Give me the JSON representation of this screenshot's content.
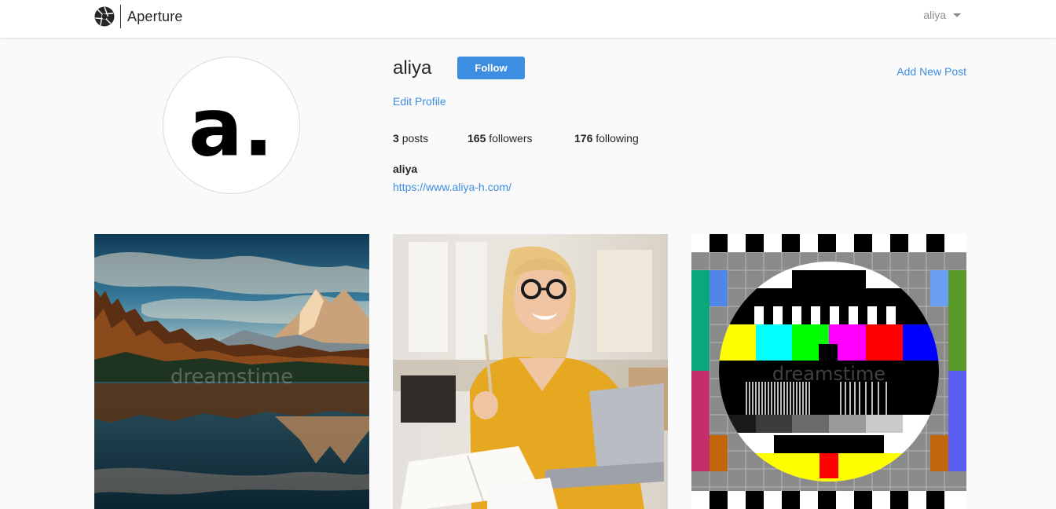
{
  "app": {
    "name": "Aperture"
  },
  "nav": {
    "username": "aliya"
  },
  "profile": {
    "username": "aliya",
    "follow_label": "Follow",
    "edit_label": "Edit Profile",
    "add_post_label": "Add New Post",
    "stats": {
      "posts_count": "3",
      "posts_label": "posts",
      "followers_count": "165",
      "followers_label": "followers",
      "following_count": "176",
      "following_label": "following"
    },
    "full_name": "aliya",
    "website": "https://www.aliya-h.com/",
    "avatar_text": "a."
  },
  "posts": [
    {
      "subject": "mountain lake reflection",
      "watermark": "dreamstime"
    },
    {
      "subject": "smiling woman with laptop",
      "watermark": ""
    },
    {
      "subject": "tv test pattern",
      "watermark": "dreamstime"
    }
  ],
  "colors": {
    "accent": "#3d8ee0",
    "background": "#fafafa",
    "text": "#262626",
    "muted": "#8e8e8e"
  },
  "icons": {
    "brand": "aperture-icon",
    "user_menu": "caret-down-icon"
  }
}
